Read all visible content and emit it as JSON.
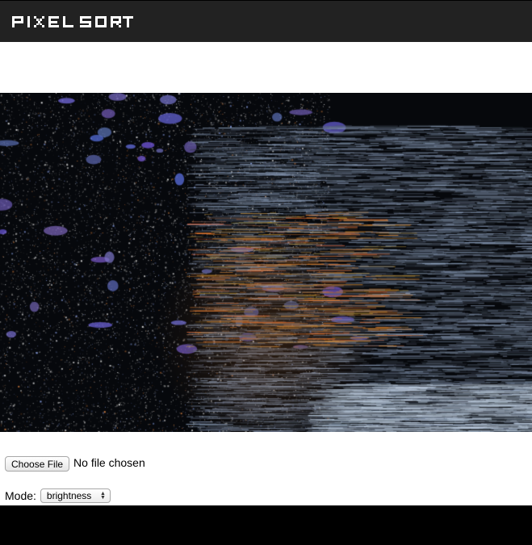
{
  "header": {
    "logo_text": "PIXELSORT"
  },
  "image": {
    "description_icon": "pixel-sorted-night-scene"
  },
  "file_input": {
    "button_label": "Choose File",
    "status": "No file chosen"
  },
  "mode": {
    "label": "Mode:",
    "selected": "brightness"
  },
  "colors": {
    "header_bg": "#222222",
    "footer_bg": "#000000",
    "logo": "#ffffff"
  }
}
